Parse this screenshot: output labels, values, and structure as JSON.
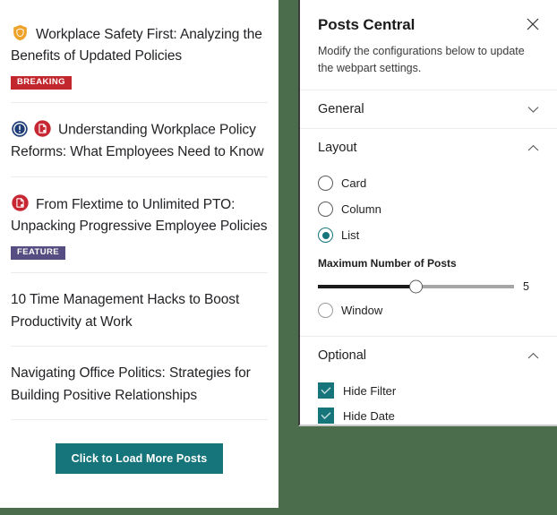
{
  "theme": {
    "page_background": "#4b6d4b",
    "accent_teal": "#15757a",
    "badge_breaking": "#c1272d",
    "badge_feature": "#564d82",
    "icon_shield": "#eda32a",
    "icon_alert": "#1f3d77",
    "icon_document": "#c62732"
  },
  "posts_webpart": {
    "load_more_label": "Click to Load More Posts",
    "items": [
      {
        "icons": [
          "shield-icon"
        ],
        "title": "Workplace Safety First: Analyzing the Benefits of Updated Policies",
        "badge": "BREAKING",
        "badge_type": "breaking"
      },
      {
        "icons": [
          "alert-circle-icon",
          "document-circle-icon"
        ],
        "title": "Understanding Workplace Policy Reforms: What Employees Need to Know",
        "badge": "",
        "badge_type": ""
      },
      {
        "icons": [
          "document-circle-icon"
        ],
        "title": "From Flextime to Unlimited PTO: Unpacking Progressive Employee Policies",
        "badge": "FEATURE",
        "badge_type": "feature"
      },
      {
        "icons": [],
        "title": "10 Time Management Hacks to Boost Productivity at Work",
        "badge": "",
        "badge_type": ""
      },
      {
        "icons": [],
        "title": "Navigating Office Politics: Strategies for Building Positive Relationships",
        "badge": "",
        "badge_type": ""
      }
    ]
  },
  "property_pane": {
    "title": "Posts Central",
    "description": "Modify the configurations below to update the webpart settings.",
    "close_icon": "close-icon",
    "sections": {
      "general": {
        "label": "General",
        "expanded": false,
        "chevron": "chevron-down-icon"
      },
      "layout": {
        "label": "Layout",
        "expanded": true,
        "chevron": "chevron-up-icon",
        "options": [
          {
            "label": "Card",
            "selected": false
          },
          {
            "label": "Column",
            "selected": false
          },
          {
            "label": "List",
            "selected": true
          }
        ],
        "slider": {
          "label": "Maximum Number of Posts",
          "value": "5",
          "min": 0,
          "max": 10,
          "percent": 50
        },
        "window_option": {
          "label": "Window",
          "selected": false
        }
      },
      "optional": {
        "label": "Optional",
        "expanded": true,
        "chevron": "chevron-up-icon",
        "checkboxes": [
          {
            "label": "Hide Filter",
            "checked": true
          },
          {
            "label": "Hide Date",
            "checked": true
          }
        ]
      }
    }
  }
}
